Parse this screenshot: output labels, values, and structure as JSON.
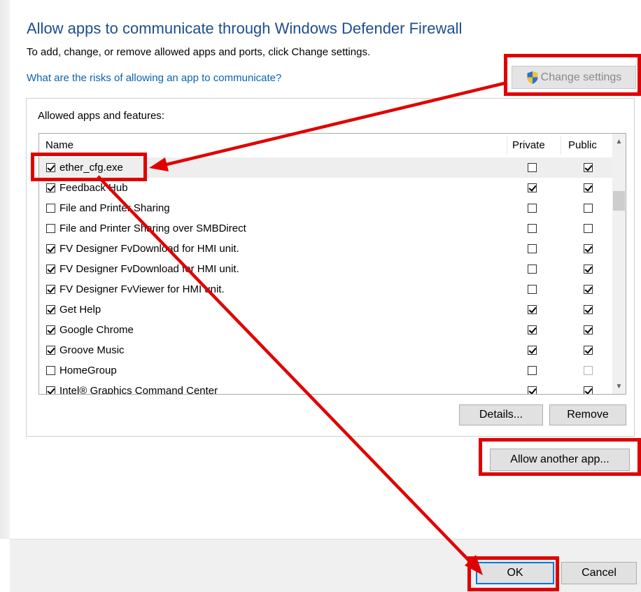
{
  "header": {
    "title": "Allow apps to communicate through Windows Defender Firewall",
    "subtitle": "To add, change, or remove allowed apps and ports, click Change settings.",
    "risk_link": "What are the risks of allowing an app to communicate?",
    "change_settings_label": "Change settings"
  },
  "apps_group": {
    "label": "Allowed apps and features:",
    "columns": {
      "name": "Name",
      "private": "Private",
      "public": "Public"
    },
    "rows": [
      {
        "name": "ether_cfg.exe",
        "enabled": true,
        "private": false,
        "public": true,
        "selected": true
      },
      {
        "name": "Feedback Hub",
        "enabled": true,
        "private": true,
        "public": true
      },
      {
        "name": "File and Printer Sharing",
        "enabled": false,
        "private": false,
        "public": false
      },
      {
        "name": "File and Printer Sharing over SMBDirect",
        "enabled": false,
        "private": false,
        "public": false
      },
      {
        "name": "FV Designer FvDownload for HMI unit.",
        "enabled": true,
        "private": false,
        "public": true
      },
      {
        "name": "FV Designer FvDownload for HMI unit.",
        "enabled": true,
        "private": false,
        "public": true
      },
      {
        "name": "FV Designer FvViewer for HMI unit.",
        "enabled": true,
        "private": false,
        "public": true
      },
      {
        "name": "Get Help",
        "enabled": true,
        "private": true,
        "public": true
      },
      {
        "name": "Google Chrome",
        "enabled": true,
        "private": true,
        "public": true
      },
      {
        "name": "Groove Music",
        "enabled": true,
        "private": true,
        "public": true
      },
      {
        "name": "HomeGroup",
        "enabled": false,
        "private": false,
        "public": false,
        "public_dim": true
      },
      {
        "name": "Intel® Graphics Command Center",
        "enabled": true,
        "private": true,
        "public": true
      }
    ],
    "details_label": "Details...",
    "remove_label": "Remove"
  },
  "allow_another_label": "Allow another app...",
  "footer": {
    "ok_label": "OK",
    "cancel_label": "Cancel"
  },
  "icons": {
    "shield": "uac-shield-icon",
    "scroll_up": "chevron-up-icon",
    "scroll_down": "chevron-down-icon"
  },
  "colors": {
    "title": "#1e4e8c",
    "link": "#0b63b0",
    "annotation": "#e00000",
    "default_button_border": "#0078d7"
  }
}
